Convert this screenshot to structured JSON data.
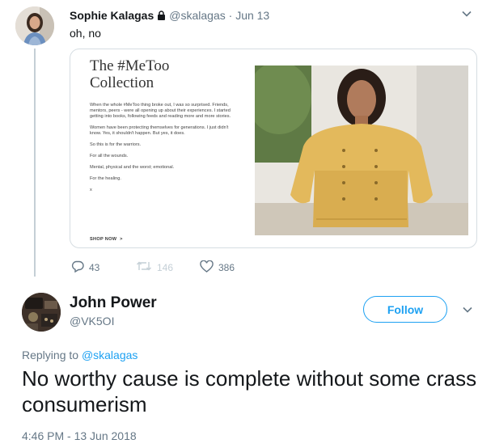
{
  "parent_tweet": {
    "name": "Sophie Kalagas",
    "handle": "@skalagas",
    "separator": "·",
    "date": "Jun 13",
    "text": "oh, no",
    "card": {
      "title_line1": "The #MeToo",
      "title_line2": "Collection",
      "paragraphs": [
        "When the whole #MeToo thing broke out, I was so surprised. Friends, mentors, peers - were all opening up about their experiences. I started getting into books, following feeds and reading more and more stories.",
        "Women have been protecting themselves for generations. I just didn't know. Yes, it shouldn't happen. But yes, it does.",
        "So this is for the warriors.",
        "For all the wounds.",
        "Mental, physical and the worst; emotional.",
        "For the healing.",
        "x"
      ],
      "shop_label": "SHOP NOW",
      "shop_arrow": ">"
    },
    "actions": {
      "replies": "43",
      "retweets": "146",
      "likes": "386"
    }
  },
  "reply_tweet": {
    "name": "John Power",
    "handle": "@VK5OI",
    "follow_label": "Follow",
    "replying_prefix": "Replying to",
    "replying_to": "@skalagas",
    "text": "No worthy cause is complete without some crass consumerism",
    "timestamp": "4:46 PM - 13 Jun 2018"
  },
  "colors": {
    "accent": "#1da1f2",
    "muted": "#657786",
    "text": "#14171a",
    "thread_line": "#c4cfd6"
  },
  "icons": {
    "lock": "lock-icon",
    "caret": "chevron-down-icon",
    "reply": "reply-icon",
    "retweet": "retweet-icon",
    "like": "heart-icon"
  }
}
